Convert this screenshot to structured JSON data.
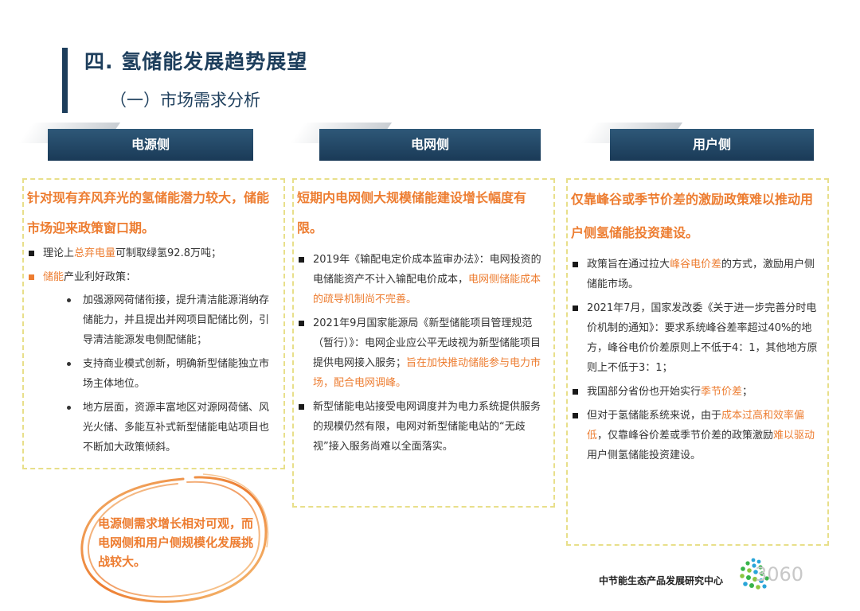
{
  "header": {
    "title": "四. 氢储能发展趋势展望",
    "subtitle": "（一）市场需求分析"
  },
  "columns": [
    {
      "banner": "电源侧",
      "headline": "针对现有弃风弃光的氢储能潜力较大，储能市场迎来政策窗口期。",
      "b1_pre": "理论上",
      "b1_hl": "总弃电量",
      "b1_post": "可制取绿氢92.8万吨；",
      "b2_hl": "储能",
      "b2_post": "产业利好政策：",
      "subs": [
        "加强源网荷储衔接，提升清洁能源消纳存储能力，并且提出并网项目配储比例，引导清洁能源发电侧配储能；",
        "支持商业模式创新，明确新型储能独立市场主体地位。",
        "地方层面，资源丰富地区对源网荷储、风光火储、多能互补式新型储能电站项目也不断加大政策倾斜。"
      ]
    },
    {
      "banner": "电网侧",
      "headline": "短期内电网侧大规模储能建设增长幅度有限。",
      "b1": "2019年《输配电定价成本监审办法》：电网投资的电储能资产不计入输配电价成本，",
      "b1_hl": "电网侧储能成本的疏导机制尚不完善。",
      "b2": "2021年9月国家能源局《新型储能项目管理规范（暂行）》：电网企业应公平无歧视为新型储能项目提供电网接入服务；",
      "b2_hl": "旨在加快推动储能参与电力市场，配合电网调峰。",
      "b3": "新型储能电站接受电网调度并为电力系统提供服务的规模仍然有限，电网对新型储能电站的“无歧视”接入服务尚难以全面落实。"
    },
    {
      "banner": "用户侧",
      "headline": "仅靠峰谷或季节价差的激励政策难以推动用户侧氢储能投资建设。",
      "b1_pre": "政策旨在通过拉大",
      "b1_hl": "峰谷电价差",
      "b1_post": "的方式，激励用户侧储能市场。",
      "b2": "2021年7月，国家发改委《关于进一步完善分时电价机制的通知》：要求系统峰谷差率超过40%的地方，峰谷电价价差原则上不低于4：1，其他地方原则上不低于3：1；",
      "b3_pre": "我国部分省份也开始实行",
      "b3_hl": "季节价差",
      "b3_post": "；",
      "b4_pre": "但对于氢储能系统来说，由于",
      "b4_hl1": "成本过高和效率偏低",
      "b4_mid": "，仅靠峰谷价差或季节价差的政策激励",
      "b4_hl2": "难以驱动",
      "b4_post": "用户侧氢储能投资建设。"
    }
  ],
  "callout": "电源侧需求增长相对可观，而电网侧和用户侧规模化发展挑战较大。",
  "footer": {
    "org": "中节能生态产品发展研究中心",
    "watermark": "3060"
  },
  "colors": {
    "accent": "#ed7d31",
    "navy": "#1d3e5c",
    "dash": "#e8df8a"
  }
}
